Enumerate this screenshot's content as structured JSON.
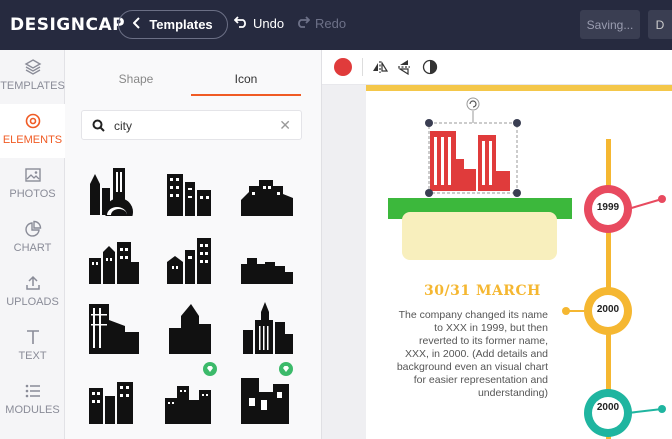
{
  "header": {
    "logo": "DESIGNCAP",
    "templates_button": "Templates",
    "undo_label": "Undo",
    "redo_label": "Redo",
    "saving_label": "Saving...",
    "download_label": "D"
  },
  "leftnav": {
    "items": [
      {
        "label": "TEMPLATES",
        "icon": "layers-icon"
      },
      {
        "label": "ELEMENTS",
        "icon": "elements-icon",
        "active": true
      },
      {
        "label": "PHOTOS",
        "icon": "image-icon"
      },
      {
        "label": "CHART",
        "icon": "pie-chart-icon"
      },
      {
        "label": "UPLOADS",
        "icon": "upload-icon"
      },
      {
        "label": "TEXT",
        "icon": "text-icon"
      },
      {
        "label": "MODULES",
        "icon": "modules-icon"
      }
    ]
  },
  "panel": {
    "tabs": [
      "Shape",
      "Icon"
    ],
    "active_tab": "Icon",
    "search_value": "city"
  },
  "canvas": {
    "date_heading": "30/31 MARCH",
    "description": "The company changed its name to XXX in 1999, but then reverted to its former name, XXX, in 2000. (Add details and background even an visual chart for easier representation and understanding)",
    "timeline": [
      "1999",
      "2000",
      "2000"
    ]
  },
  "colors": {
    "topbar": "#262a3f",
    "accent": "#f05b24",
    "selected_icon": "#e03b3b",
    "timeline_orange": "#f5b731",
    "node_red": "#e84a5f",
    "node_teal": "#1fb5a0",
    "grass": "#3cb83c"
  }
}
